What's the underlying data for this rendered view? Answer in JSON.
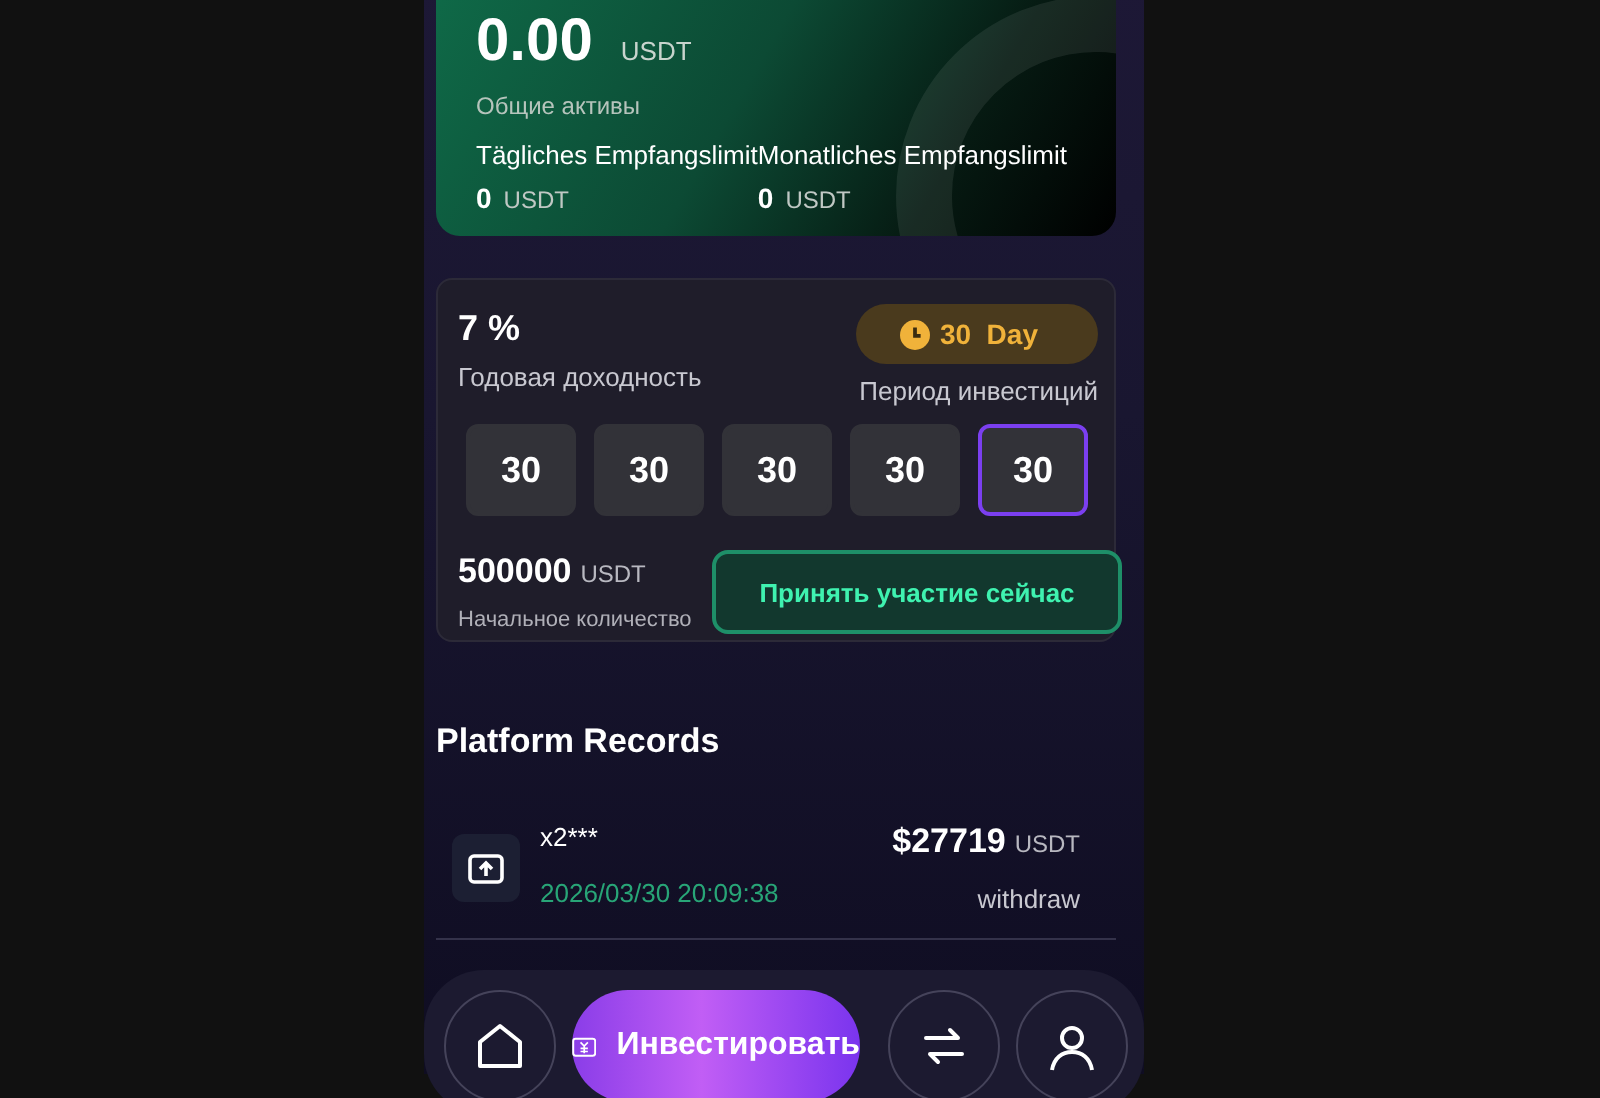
{
  "balance_card": {
    "amount": "0.00",
    "unit": "USDT",
    "label": "Общие активы",
    "limits": [
      {
        "label": "Tägliches Empfangslimit",
        "value": "0",
        "unit": "USDT"
      },
      {
        "label": "Monatliches Empfangslimit",
        "value": "0",
        "unit": "USDT"
      }
    ]
  },
  "invest_card": {
    "rate": "7 %",
    "rate_label": "Годовая доходность",
    "period_badge": "30  Day",
    "period_label": "Период инвестиций",
    "periods": [
      {
        "label": "30",
        "selected": false
      },
      {
        "label": "30",
        "selected": false
      },
      {
        "label": "30",
        "selected": false
      },
      {
        "label": "30",
        "selected": false
      },
      {
        "label": "30",
        "selected": true
      }
    ],
    "amount": "500000",
    "amount_unit": "USDT",
    "amount_label": "Начальное количество",
    "join_button": "Принять участие сейчас"
  },
  "records": {
    "title": "Platform Records",
    "rows": [
      {
        "user": "x2***",
        "time": "2026/03/30 20:09:38",
        "amount": "$27719",
        "unit": "USDT",
        "type": "withdraw"
      }
    ]
  },
  "nav": {
    "invest_button": "Инвестировать"
  }
}
